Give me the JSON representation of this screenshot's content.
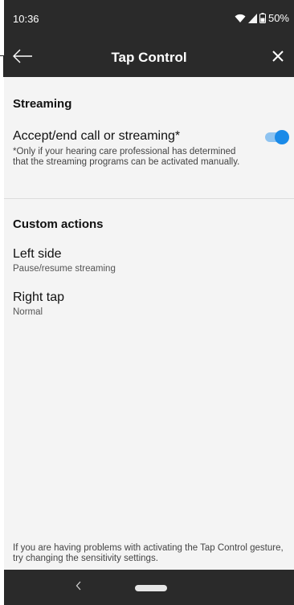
{
  "status_bar": {
    "time": "10:36",
    "battery": "50%",
    "icons": [
      "wifi-icon",
      "signal-icon",
      "battery-icon"
    ]
  },
  "header": {
    "title": "Tap Control",
    "back_icon": "arrow-left-icon",
    "close_icon": "close-icon"
  },
  "streaming": {
    "section_title": "Streaming",
    "toggle_label": "Accept/end call or streaming*",
    "toggle_on": true,
    "note": "*Only if your hearing care professional has determined that the streaming programs can be activated manually."
  },
  "custom_actions": {
    "section_title": "Custom actions",
    "items": [
      {
        "title": "Left side",
        "subtitle": "Pause/resume streaming"
      },
      {
        "title": "Right tap",
        "subtitle": "Normal"
      }
    ]
  },
  "footer": {
    "note": "If you are having problems with activating the Tap Control gesture, try changing the sensitivity settings."
  },
  "colors": {
    "bar_background": "#2a2a2a",
    "content_background": "#f4f4f4",
    "toggle_accent": "#1a8ae8"
  }
}
